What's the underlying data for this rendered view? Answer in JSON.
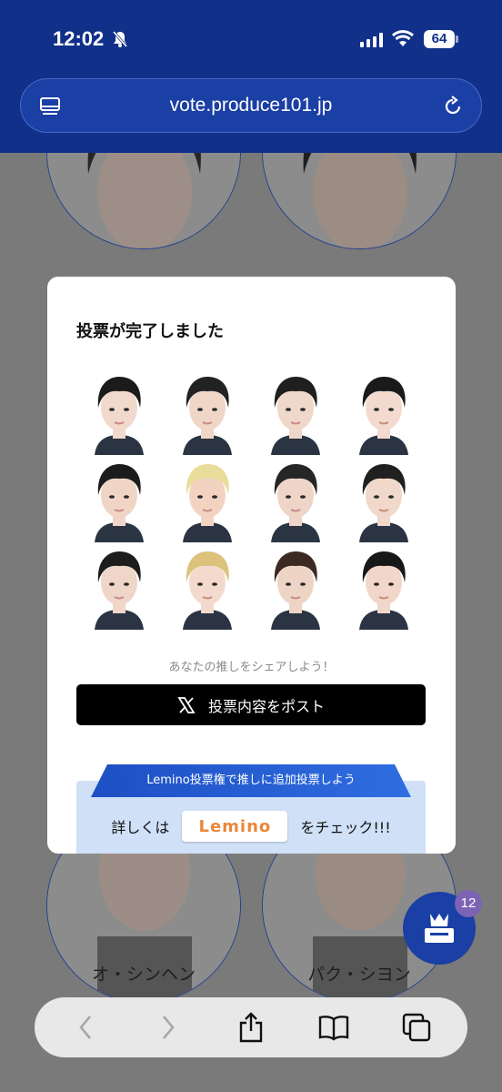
{
  "status": {
    "time": "12:02",
    "battery": "64"
  },
  "browser": {
    "url": "vote.produce101.jp"
  },
  "background": {
    "names": [
      "オ・シンヘン",
      "パク・シヨン"
    ]
  },
  "modal": {
    "title": "投票が完了しました",
    "faces_count": 12,
    "share_prompt": "あなたの推しをシェアしよう！",
    "post_button": "投票内容をポスト",
    "lemino_banner": "Lemino投票権で推しに追加投票しよう",
    "lemino_prefix": "詳しくは",
    "lemino_logo": "Lemino",
    "lemino_suffix": "をチェック!!!"
  },
  "fab": {
    "badge": "12"
  },
  "colors": {
    "brand": "#11308a",
    "accent": "#1a3fa5",
    "lemino_orange": "#e9873a"
  },
  "icons": [
    "bell-slash-icon",
    "signal-icon",
    "wifi-icon",
    "tabs-icon",
    "reload-icon",
    "x-logo-icon",
    "crown-box-icon",
    "back-icon",
    "forward-icon",
    "share-icon",
    "bookmarks-icon",
    "tabs-overview-icon"
  ]
}
